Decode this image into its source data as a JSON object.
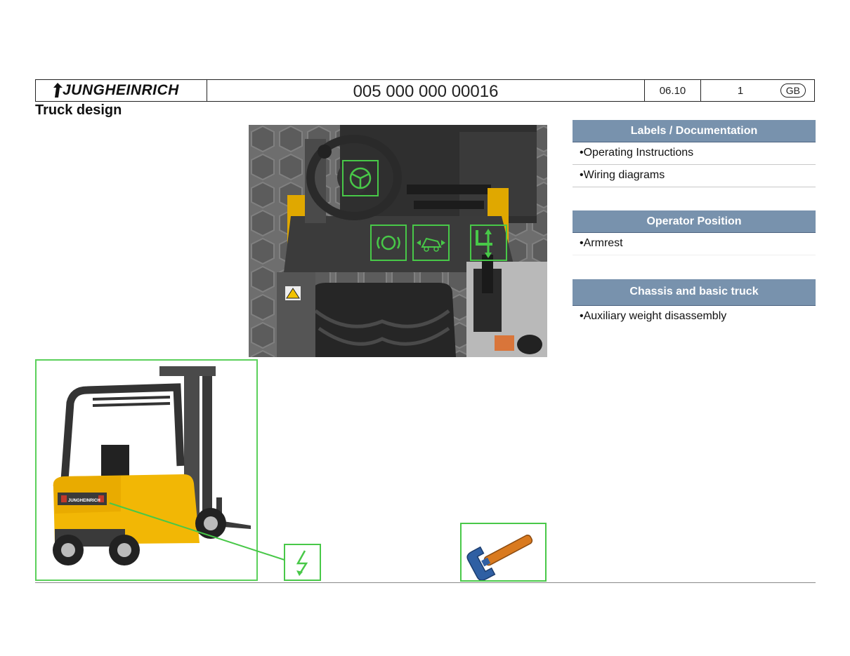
{
  "header": {
    "brand": "JUNGHEINRICH",
    "doc_number": "005 000 000 00016",
    "date": "06.10",
    "page": "1",
    "lang": "GB"
  },
  "title": "Truck design",
  "sections": [
    {
      "heading": "Labels / Documentation",
      "items": [
        "Operating Instructions",
        "Wiring diagrams"
      ]
    },
    {
      "heading": "Operator Position",
      "items": [
        "Armrest"
      ]
    },
    {
      "heading": "Chassis and basic truck",
      "items": [
        "Auxiliary weight disassembly"
      ]
    }
  ],
  "bullet": "•",
  "colors": {
    "accent_green": "#48c848",
    "section_header": "#7892ad",
    "forklift_yellow": "#f2b705"
  },
  "icons": [
    "steering-wheel-icon",
    "brake-icon",
    "tilt-icon",
    "lift-lever-icon",
    "electrical-hazard-icon",
    "wrench-icon"
  ]
}
